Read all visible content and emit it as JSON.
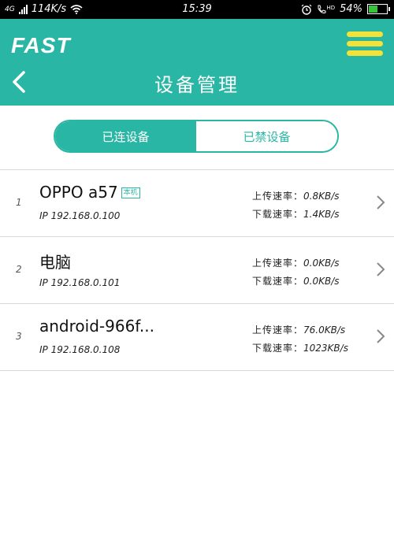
{
  "status_bar": {
    "network": "4G",
    "speed": "114K/s",
    "time": "15:39",
    "volte": "HD",
    "battery": "54%",
    "battery_level": 0.54,
    "battery_color": "#38c33c"
  },
  "header": {
    "logo": "FAST",
    "title": "设备管理",
    "color": "#2ab6a4",
    "menu_color": "#f3e23a"
  },
  "tabs": [
    {
      "label": "已连设备",
      "active": true
    },
    {
      "label": "已禁设备",
      "active": false
    }
  ],
  "devices": [
    {
      "index": "1",
      "name": "OPPO a57",
      "badge": "本机",
      "ip": "IP 192.168.0.100",
      "upload_label": "上传速率：",
      "upload": "0.8KB/s",
      "download_label": "下载速率：",
      "download": "1.4KB/s"
    },
    {
      "index": "2",
      "name": "电脑",
      "badge": "",
      "ip": "IP 192.168.0.101",
      "upload_label": "上传速率：",
      "upload": "0.0KB/s",
      "download_label": "下载速率：",
      "download": "0.0KB/s"
    },
    {
      "index": "3",
      "name": "android-966f...",
      "badge": "",
      "ip": "IP 192.168.0.108",
      "upload_label": "上传速率：",
      "upload": "76.0KB/s",
      "download_label": "下载速率：",
      "download": "1023KB/s"
    }
  ]
}
